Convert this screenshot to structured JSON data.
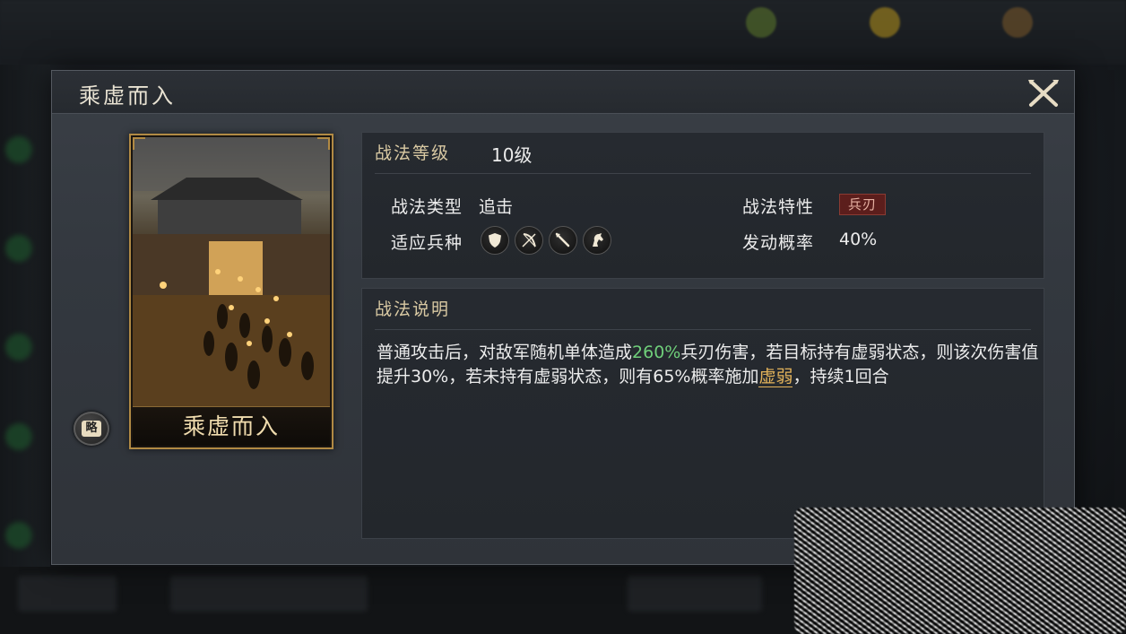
{
  "modal": {
    "title": "乘虚而入"
  },
  "card": {
    "name": "乘虚而入",
    "badge": "略"
  },
  "stats": {
    "level_label": "战法等级",
    "level_value": "10级",
    "type_label": "战法类型",
    "type_value": "追击",
    "trait_label": "战法特性",
    "trait_value": "兵刃",
    "units_label": "适应兵种",
    "units": [
      "shield-icon",
      "bow-icon",
      "spear-icon",
      "horse-icon"
    ],
    "rate_label": "发动概率",
    "rate_value": "40%"
  },
  "description": {
    "heading": "战法说明",
    "part1": "普通攻击后，对敌军随机单体造成",
    "damage_pct": "260%",
    "part2": "兵刃伤害，若目标持有虚弱状态，则该次伤害值提升30%，若未持有虚弱状态，则有65%概率施加",
    "status_link": "虚弱",
    "part3": "，持续1回合"
  },
  "colors": {
    "accent_gold": "#b18a44",
    "highlight_green": "#6fcf7a",
    "link_gold": "#e2b25a",
    "trait_red": "#5c1e1c"
  }
}
